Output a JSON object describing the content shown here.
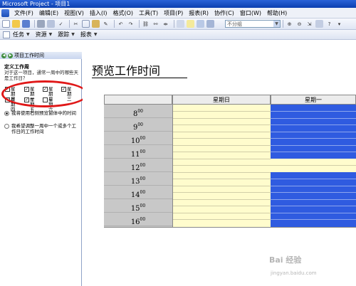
{
  "window": {
    "title": "Microsoft Project - 项目1"
  },
  "menu": {
    "items": [
      "文件(F)",
      "编辑(E)",
      "视图(V)",
      "插入(I)",
      "格式(O)",
      "工具(T)",
      "项目(P)",
      "报表(R)",
      "协作(C)",
      "窗口(W)",
      "帮助(H)"
    ]
  },
  "toolbar": {
    "group_value": "不分组"
  },
  "guide_bar": {
    "tasks": "任务",
    "resources": "资源",
    "track": "跟踪",
    "report": "报表"
  },
  "side_pane": {
    "header": "项目工作时间",
    "title": "定义工作周",
    "description": "对于这一项目，通常一周中的哪些天是工作日？",
    "days": [
      {
        "label": "星期日",
        "checked": true
      },
      {
        "label": "星期一",
        "checked": true
      },
      {
        "label": "星期二",
        "checked": true
      },
      {
        "label": "星期三",
        "checked": true
      },
      {
        "label": "星期四",
        "checked": true
      },
      {
        "label": "星期五",
        "checked": true
      },
      {
        "label": "星期六",
        "checked": false
      }
    ],
    "options": [
      {
        "label": "我将使用右侧预览窗体中的时间",
        "selected": true
      },
      {
        "label": "我希望调整一周中一个或多个工作日的工作时间",
        "selected": false
      }
    ]
  },
  "preview": {
    "title": "预览工作时间",
    "columns": [
      "星期日",
      "星期一"
    ],
    "hours": [
      "8",
      "9",
      "10",
      "11",
      "12",
      "13",
      "14",
      "15",
      "16"
    ],
    "minutes": "00"
  },
  "watermark": {
    "line1": "Bai 经验",
    "line2": "jingyan.baidu.com"
  },
  "colors": {
    "working_time": "#2f5be0",
    "nonworking_time": "#fffccd",
    "highlight": "#e01818"
  }
}
